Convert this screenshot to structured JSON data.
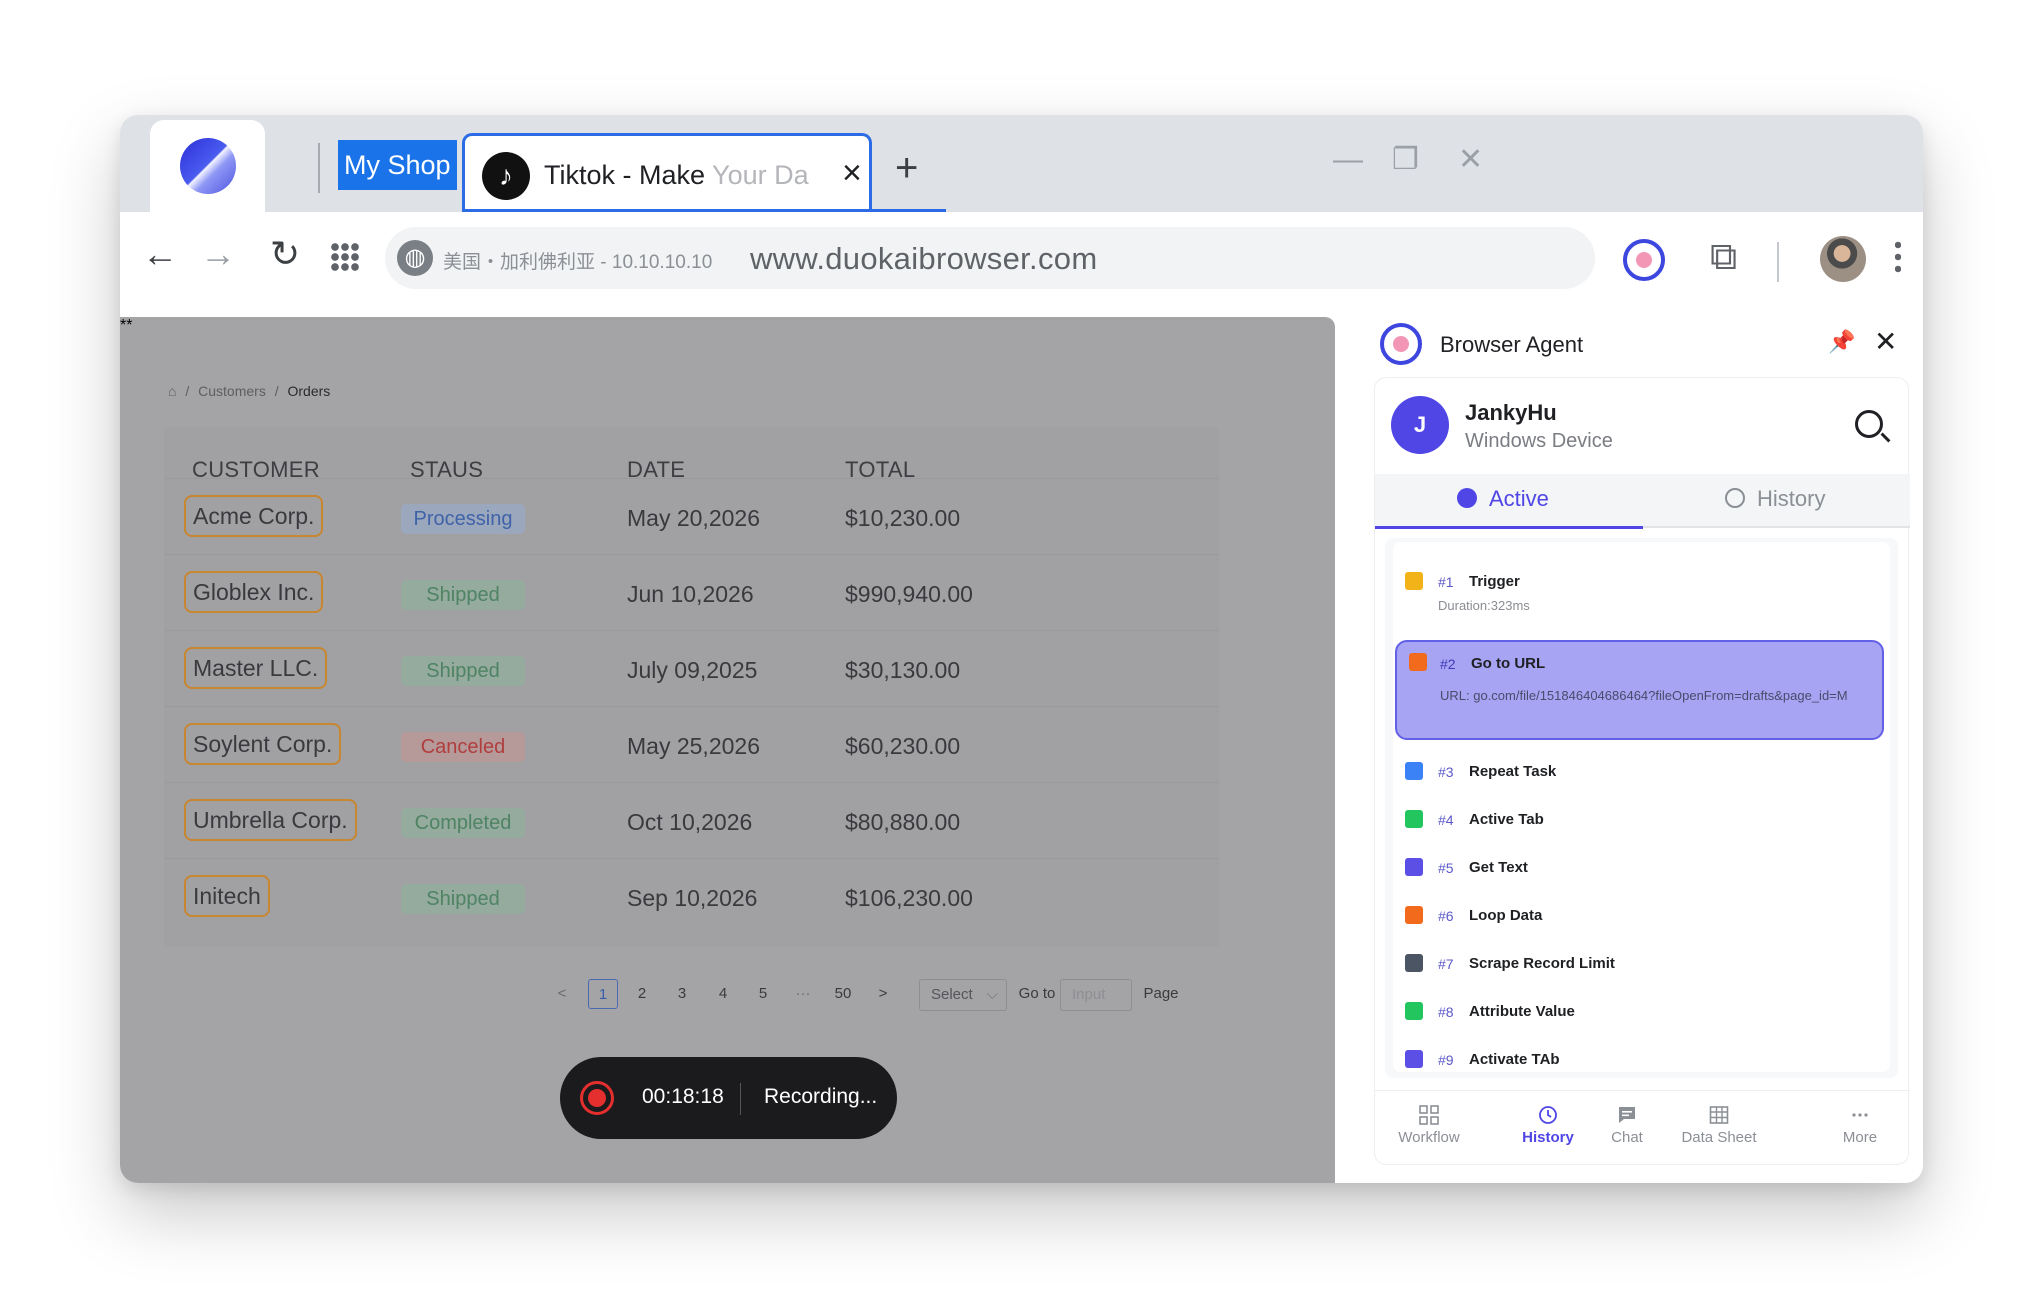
{
  "browser": {
    "shop_tab_label": "My Shop",
    "active_tab": {
      "title": "Tiktok - Make ",
      "title_faded": "Your Da",
      "icon": "tiktok-icon"
    },
    "new_tab": "+",
    "window_controls": {
      "minimize": "—",
      "restore": "❐",
      "close": "✕"
    },
    "nav": {
      "back": "←",
      "forward": "→",
      "reload": "↻"
    },
    "location": "美国・加利佛利亚 - 10.10.10.10",
    "url": "www.duokaibrowser.com"
  },
  "page": {
    "breadcrumb": {
      "home_icon": "⌂",
      "sep": "/",
      "customers": "Customers",
      "orders": "Orders"
    },
    "columns": [
      "CUSTOMER",
      "STAUS",
      "DATE",
      "TOTAL"
    ],
    "rows": [
      {
        "customer": "Acme Corp.",
        "status": "Processing",
        "date": "May 20,2026",
        "total": "$10,230.00"
      },
      {
        "customer": "Globlex Inc.",
        "status": "Shipped",
        "date": "Jun 10,2026",
        "total": "$990,940.00"
      },
      {
        "customer": "Master LLC.",
        "status": "Shipped",
        "date": "July 09,2025",
        "total": "$30,130.00"
      },
      {
        "customer": "Soylent Corp.",
        "status": "Canceled",
        "date": "May 25,2026",
        "total": "$60,230.00"
      },
      {
        "customer": "Umbrella Corp.",
        "status": "Completed",
        "date": "Oct 10,2026",
        "total": "$80,880.00"
      },
      {
        "customer": "Initech",
        "status": "Shipped",
        "date": "Sep 10,2026",
        "total": "$106,230.00"
      }
    ],
    "pagination": {
      "prev": "<",
      "pages": [
        "1",
        "2",
        "3",
        "4",
        "5"
      ],
      "ellipsis": "···",
      "last": "50",
      "next": ">",
      "current": "1",
      "select_label": "Select",
      "select_arrow": "⌵",
      "goto_label": "Go to",
      "input_placeholder": "Input",
      "page_label": "Page"
    },
    "recording": {
      "time": "00:18:18",
      "label": "Recording..."
    }
  },
  "agent": {
    "title": "Browser Agent",
    "pin_icon": "📌",
    "close": "✕",
    "user": {
      "initial": "J",
      "name": "JankyHu",
      "device": "Windows Device"
    },
    "tabs": {
      "active": "Active",
      "history": "History"
    },
    "steps": [
      {
        "num": "#1",
        "name": "Trigger",
        "detail": "Duration:323ms",
        "color": "#f2b318"
      },
      {
        "num": "#2",
        "name": "Go to URL",
        "detail": "URL:  go.com/file/151846404686464?fileOpenFrom=drafts&page_id=M",
        "color": "#f26b1d"
      },
      {
        "num": "#3",
        "name": "Repeat Task",
        "color": "#3b82f6"
      },
      {
        "num": "#4",
        "name": "Active Tab",
        "color": "#22c55e"
      },
      {
        "num": "#5",
        "name": "Get Text",
        "color": "#5b4fe6"
      },
      {
        "num": "#6",
        "name": "Loop Data",
        "color": "#f26b1d"
      },
      {
        "num": "#7",
        "name": "Scrape Record Limit",
        "color": "#4b5563"
      },
      {
        "num": "#8",
        "name": "Attribute Value",
        "color": "#22c55e"
      },
      {
        "num": "#9",
        "name": "Activate TAb",
        "color": "#5b4fe6"
      }
    ],
    "bottom_nav": [
      "Workflow",
      "History",
      "Chat",
      "Data Sheet",
      "More"
    ],
    "bottom_nav_active": "History"
  },
  "colors": {
    "accent": "#4f46e5",
    "chrome_blue": "#1a73e8",
    "tab_strip": "#dee1e6",
    "overlay": "#a4a4a6"
  }
}
